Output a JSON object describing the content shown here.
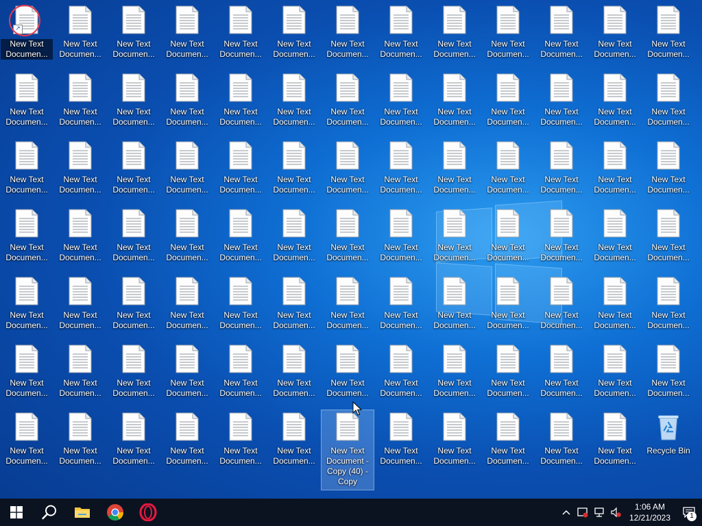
{
  "desktop": {
    "text_file_label": "New Text Documen...",
    "selected_item_label": "New Text Document - Copy (40) - Copy",
    "recycle_bin_label": "Recycle Bin"
  },
  "taskbar": {
    "start": "Start",
    "search": "Search",
    "pinned": [
      "File Explorer",
      "Google Chrome",
      "Opera"
    ],
    "clock_time": "1:06 AM",
    "clock_date": "12/21/2023",
    "notification_count": "1"
  },
  "colors": {
    "desktop_accent": "#0f6fd4",
    "taskbar": "#0b1220",
    "chrome_red": "#db4437",
    "opera_red": "#e3193f",
    "folder_yellow": "#f4c542"
  }
}
